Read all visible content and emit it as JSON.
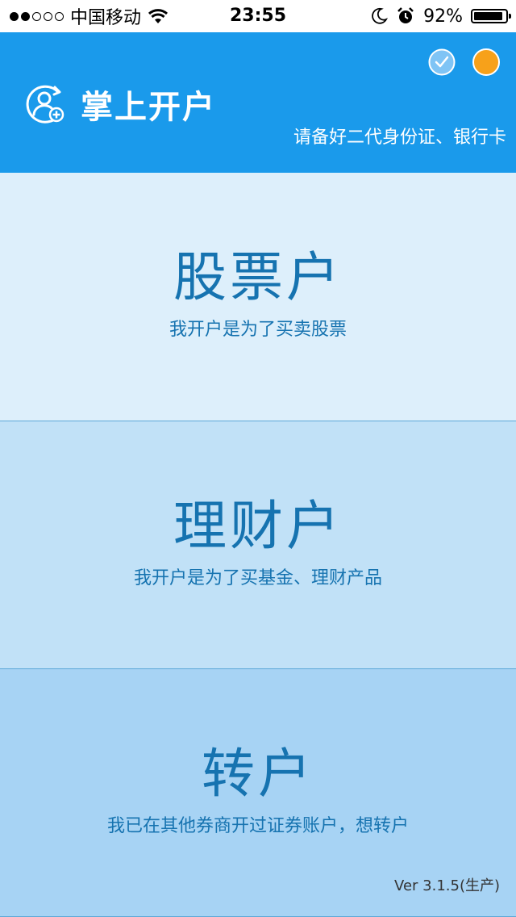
{
  "status_bar": {
    "carrier": "中国移动",
    "time": "23:55",
    "battery_percent": "92%",
    "battery_level": 0.92,
    "signal_bars_filled": 2,
    "signal_bars_total": 5
  },
  "header": {
    "title": "掌上开户",
    "subtitle": "请备好二代身份证、银行卡",
    "icon": "user-add-icon",
    "background_color": "#1a9aeb"
  },
  "options": [
    {
      "title": "股票户",
      "description": "我开户是为了买卖股票"
    },
    {
      "title": "理财户",
      "description": "我开户是为了买基金、理财产品"
    },
    {
      "title": "转户",
      "description": "我已在其他券商开过证券账户，想转户"
    }
  ],
  "footer": {
    "version": "Ver 3.1.5(生产)"
  },
  "colors": {
    "accent": "#1a9aeb",
    "option_text": "#1673b0",
    "orange_dot": "#f7a11a"
  }
}
